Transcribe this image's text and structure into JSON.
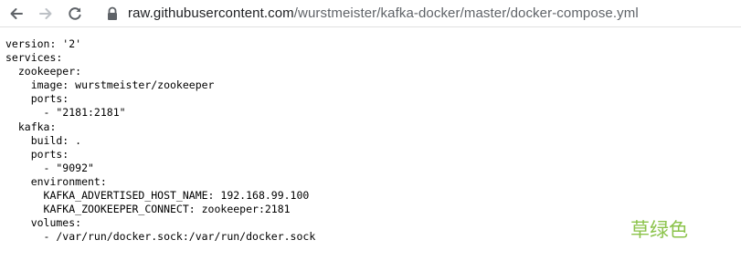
{
  "browser": {
    "url_host": "raw.githubusercontent.com",
    "url_path": "/wurstmeister/kafka-docker/master/docker-compose.yml",
    "icons": {
      "back": "arrow-back-icon",
      "forward": "arrow-forward-icon",
      "reload": "reload-icon",
      "lock": "lock-icon"
    }
  },
  "document": {
    "lines": [
      "version: '2'",
      "services:",
      "  zookeeper:",
      "    image: wurstmeister/zookeeper",
      "    ports:",
      "      - \"2181:2181\"",
      "  kafka:",
      "    build: .",
      "    ports:",
      "      - \"9092\"",
      "    environment:",
      "      KAFKA_ADVERTISED_HOST_NAME: 192.168.99.100",
      "      KAFKA_ZOOKEEPER_CONNECT: zookeeper:2181",
      "    volumes:",
      "      - /var/run/docker.sock:/var/run/docker.sock"
    ]
  },
  "watermark": {
    "text": "草绿色",
    "color": "#8bc34a"
  },
  "colors": {
    "url_host": "#202124",
    "url_path": "#5f6368",
    "icon_active": "#5f6368",
    "icon_disabled": "#bdc1c6"
  }
}
